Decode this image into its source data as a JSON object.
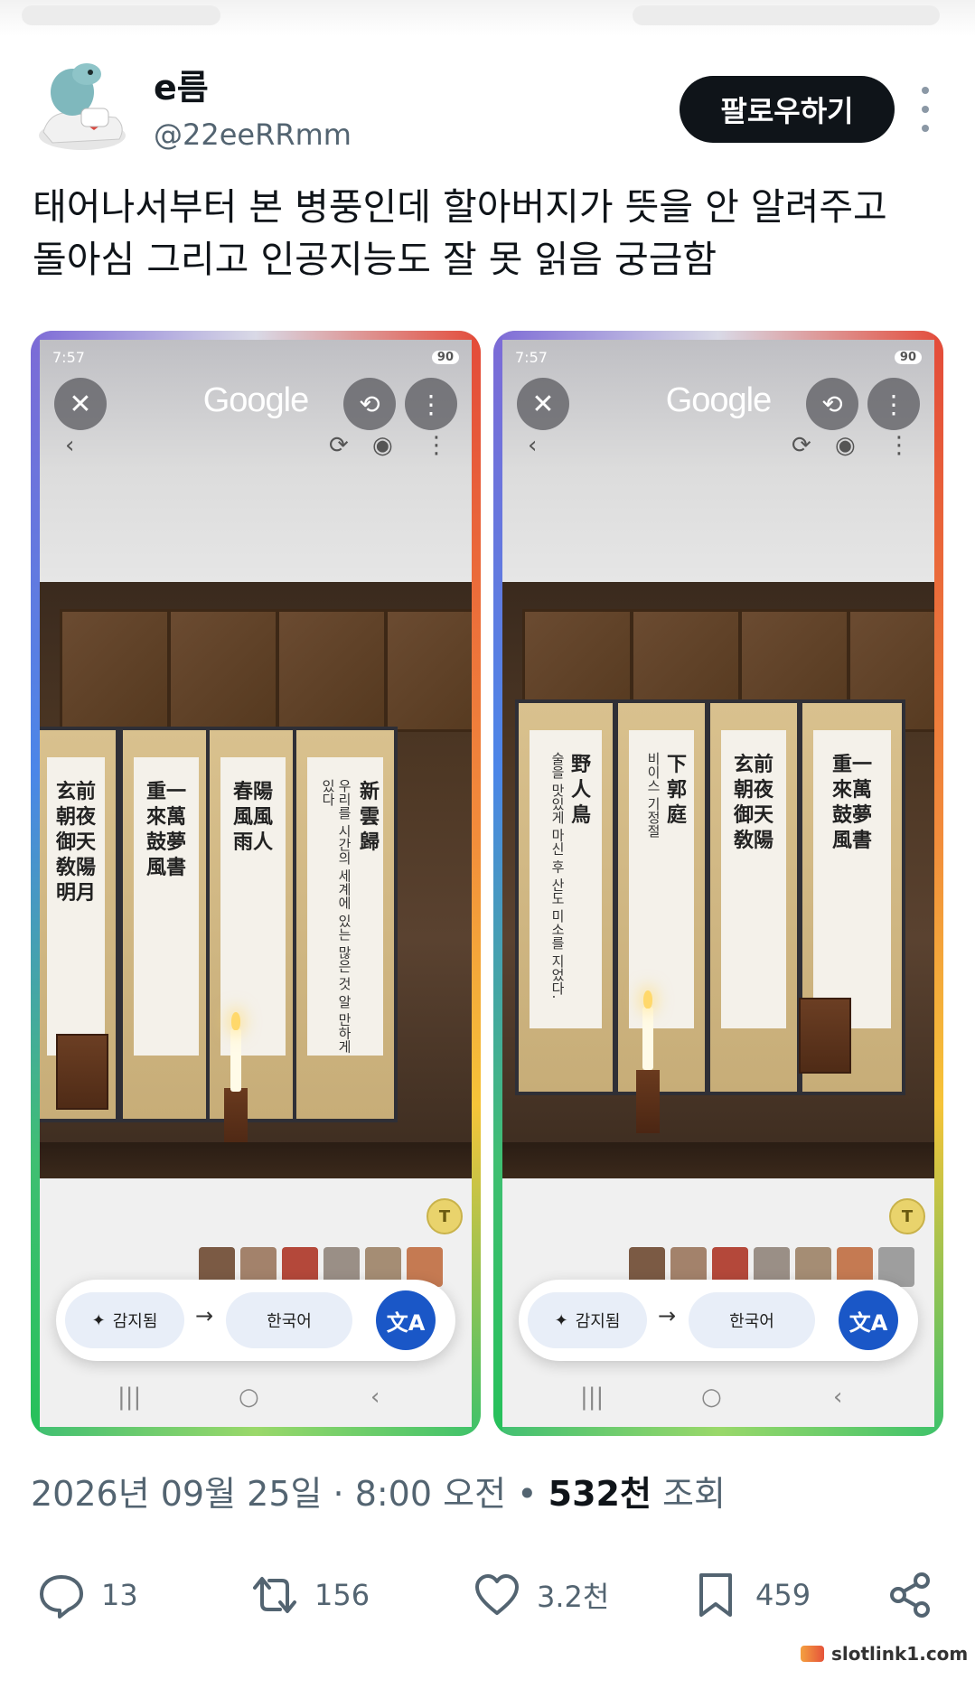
{
  "author": {
    "name": "e름",
    "handle": "@22eeRRmm",
    "follow_label": "팔로우하기"
  },
  "tweet": {
    "text": "태어나서부터 본 병풍인데 할아버지가 뜻을 안 알려주고\n돌아심 그리고 인공지능도 잘 못 읽음 궁금함"
  },
  "screenshots": [
    {
      "time": "7:57",
      "battery": "90",
      "app_title": "Google",
      "detected_label": "감지됨",
      "target_language": "한국어",
      "overlay_translation": "우리를 시간의 세계에 있는 많은 것 알 만하게 있다",
      "lens_badge": "T"
    },
    {
      "time": "7:57",
      "battery": "90",
      "app_title": "Google",
      "detected_label": "감지됨",
      "target_language": "한국어",
      "overlay_translation_a": "술을 맛있게 마신 후 산도 미소를 지었다.",
      "overlay_translation_b": "비이스 기정절",
      "lens_badge": "T"
    }
  ],
  "meta": {
    "date": "2026년 09월 25일",
    "separator": " · ",
    "time": "8:00 오전",
    "bullet": " • ",
    "views": "532천",
    "views_suffix": " 조회"
  },
  "actions": {
    "replies": "13",
    "reposts": "156",
    "likes": "3.2천",
    "bookmarks": "459"
  },
  "watermark": "slotlink1.com",
  "colors": {
    "follow_bg": "#0f1419",
    "secondary_text": "#536471",
    "translate_button": "#1a57c7"
  }
}
